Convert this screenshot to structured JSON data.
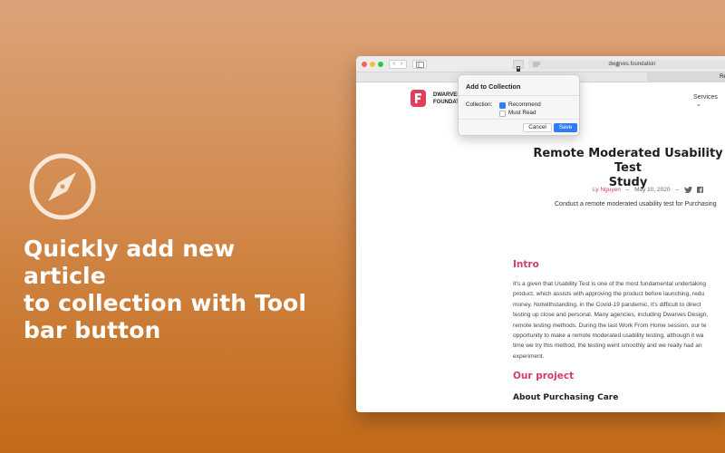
{
  "promo": {
    "headline_lines": [
      "Quickly add new article",
      "to collection with Tool",
      "bar button"
    ],
    "icon": "compass-icon"
  },
  "browser": {
    "url": "dwarves.foundation",
    "tab_label": "Re",
    "nav_back": "‹",
    "nav_forward": "›"
  },
  "site": {
    "brand_line1": "DWARVES",
    "brand_line2": "FOUNDAT",
    "nav_services": "Services"
  },
  "article": {
    "title_line1": "Remote Moderated Usability Test",
    "title_line2": "Study",
    "author": "Ly Nguyen",
    "separator": "–",
    "date": "May 10, 2020",
    "subtitle": "Conduct a remote moderated usability test for Purchasing",
    "intro_heading": "Intro",
    "intro_body": "It's a given that Usability Test is one of the most fundamental undertaking\nproduct, which assists with approving the product before launching, redu\nmoney. Notwithstanding, in the Covid-19 pandemic, it's difficult to direct\ntesting up close and personal. Many agencies, including Dwarves Design,\nremote testing methods. During the last Work From Home session, our te\nopportunity to make a remote moderated usability testing, although it wa\ntime we try this method, the testing went smoothly and we really had an\nexperiment.",
    "project_heading": "Our project",
    "project_subheading": "About Purchasing Care"
  },
  "popover": {
    "title": "Add to Collection",
    "collection_label": "Collection:",
    "options": [
      {
        "label": "Recommend",
        "checked": true
      },
      {
        "label": "Must Read",
        "checked": false
      }
    ],
    "cancel_label": "Cancel",
    "save_label": "Save"
  }
}
